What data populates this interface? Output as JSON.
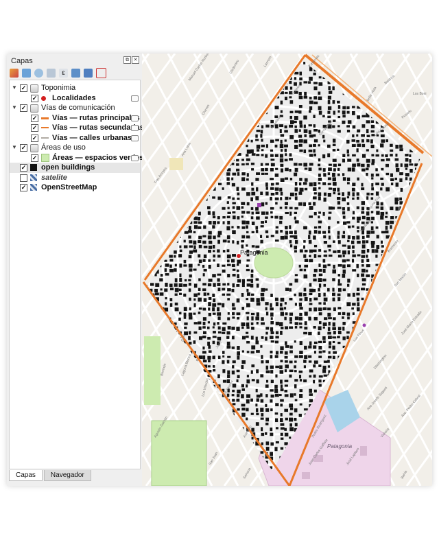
{
  "panel": {
    "title": "Capas",
    "buttons": [
      "⧉",
      "✕"
    ]
  },
  "layers": [
    {
      "key": "toponimia",
      "label": "Toponimia",
      "level": 0,
      "expanded": true,
      "checked": true,
      "group": true,
      "bold": false
    },
    {
      "key": "localidades",
      "label": "Localidades",
      "level": 1,
      "checked": true,
      "symbol": "red-dot",
      "bold": true
    },
    {
      "key": "vias",
      "label": "Vías de comunicación",
      "level": 0,
      "expanded": true,
      "checked": true,
      "group": true,
      "bold": false
    },
    {
      "key": "rutas-principales",
      "label": "Vías — rutas principales",
      "level": 1,
      "checked": true,
      "symbol": "orange-line",
      "bold": true
    },
    {
      "key": "rutas-secundarias",
      "label": "Vías — rutas secundarias",
      "level": 1,
      "checked": true,
      "symbol": "orange-thin-line",
      "bold": true
    },
    {
      "key": "calles-urbanas",
      "label": "Vías — calles urbanas",
      "level": 1,
      "checked": true,
      "symbol": "grey-line",
      "bold": true
    },
    {
      "key": "areas",
      "label": "Áreas de uso",
      "level": 0,
      "expanded": true,
      "checked": true,
      "group": true,
      "bold": false
    },
    {
      "key": "espacios-verdes",
      "label": "Áreas — espacios verdes",
      "level": 1,
      "checked": true,
      "symbol": "green-fill",
      "bold": true
    },
    {
      "key": "open-buildings",
      "label": "open buildings",
      "level": 0,
      "checked": true,
      "symbol": "black-fill",
      "bold": true,
      "selected": true
    },
    {
      "key": "satelite",
      "label": "satelite",
      "level": 0,
      "checked": false,
      "symbol": "raster",
      "bold": true,
      "italic": true
    },
    {
      "key": "osm",
      "label": "OpenStreetMap",
      "level": 0,
      "checked": true,
      "symbol": "raster",
      "bold": true
    }
  ],
  "tabs": [
    "Capas",
    "Navegador"
  ],
  "map": {
    "place_label": "Patagonia",
    "poi_label": "Patagonia",
    "streets": [
      "Manuel Carlos Norberto",
      "Clodomiro",
      "Lacroze",
      "Los Boni",
      "Lola Gabriel",
      "Rosario",
      "Baldrich",
      "Bella Vista",
      "Cavernas",
      "Rosales",
      "Rivadavia",
      "Gurruchaga",
      "Tres Arroyos",
      "Chaves",
      "Bramento",
      "San Martín",
      "Los Pinos",
      "Washington",
      "Ana Josefa Sagasti",
      "Pedro Rodríguez",
      "Acevedo",
      "Los Sauces",
      "Los Viñedos",
      "Laguna Blanca",
      "Bermejo",
      "Juan Carlos Gaffiste",
      "José Marío Estrada",
      "Ave. Pedro Cabral",
      "Victoria",
      "José Laplace",
      "Ana Loiza",
      "San Juan",
      "Agustín Garzón",
      "Sertona",
      "Jujuy",
      "Guía",
      "Bahía",
      "Los Ateos",
      "Laguna Fría"
    ],
    "colors": {
      "bg": "#f2efe9",
      "main_road": "#e8792a",
      "road": "#ffffff",
      "street_grey": "#cfcac2",
      "park": "#cdebb0",
      "industrial": "#efd5ea",
      "building": "#141414",
      "water": "#a9d3ea"
    }
  }
}
